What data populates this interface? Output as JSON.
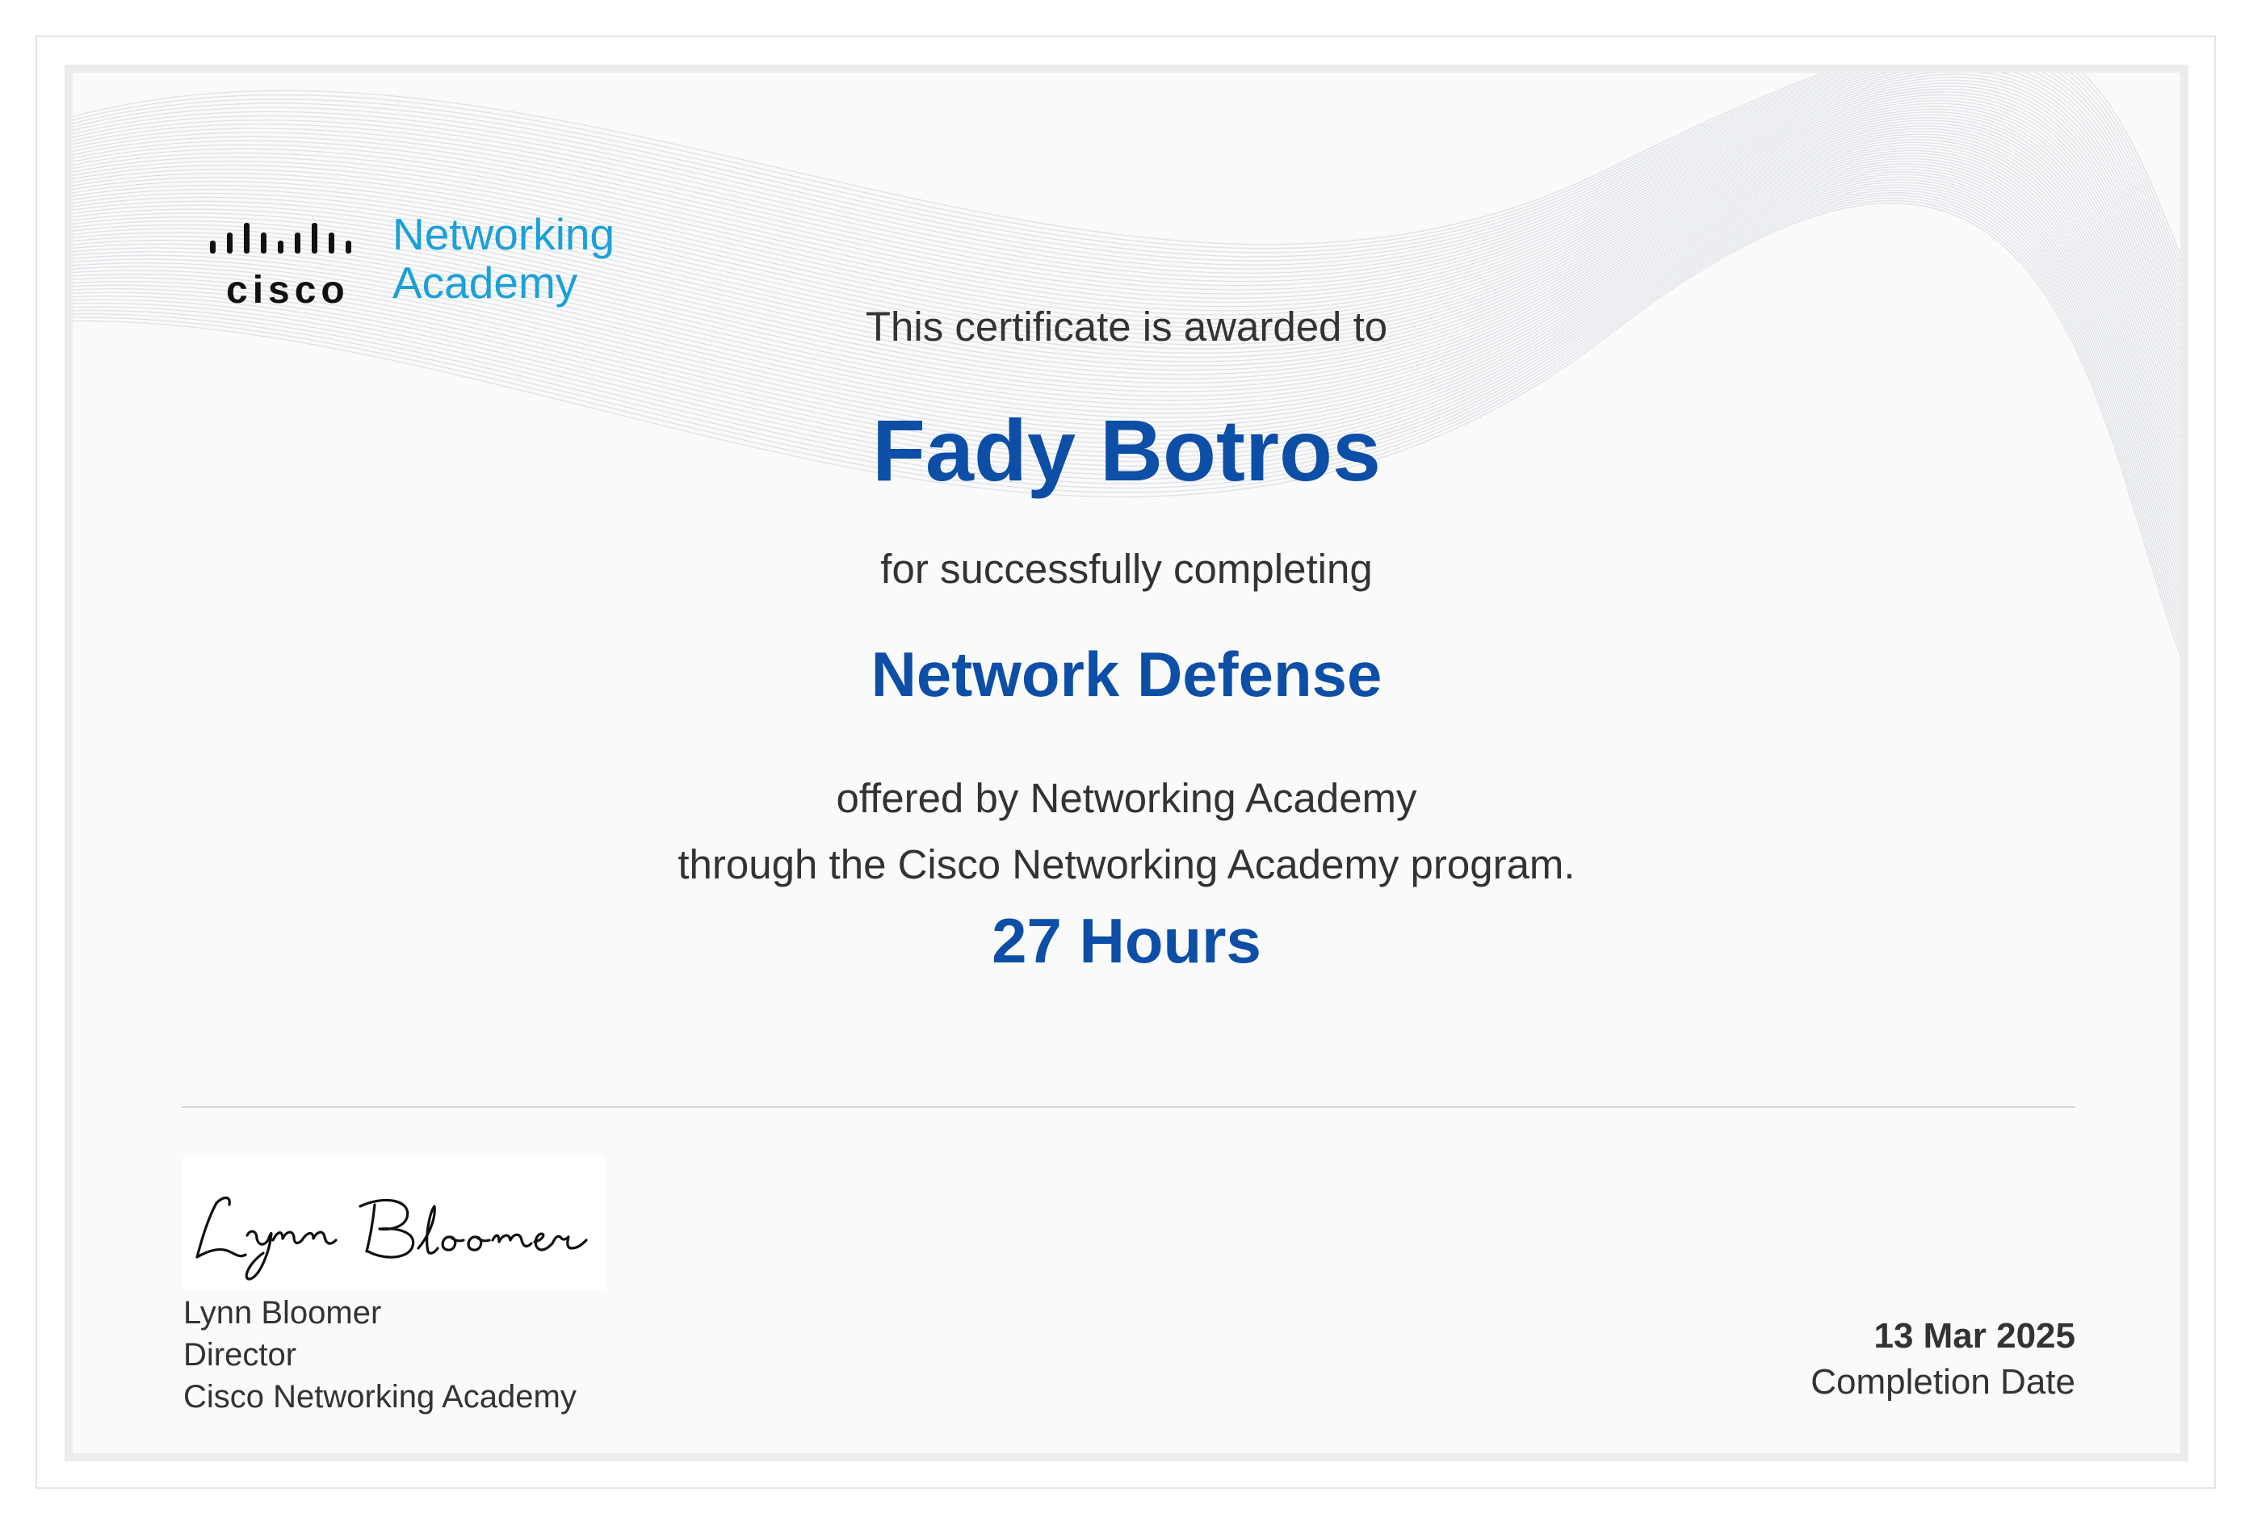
{
  "logo": {
    "wordmark": "cisco",
    "line1": "Networking",
    "line2": "Academy",
    "brand_color": "#1ba0d7"
  },
  "certificate": {
    "awarded_text": "This certificate is awarded to",
    "recipient": "Fady Botros",
    "completing_text": "for successfully completing",
    "course": "Network Defense",
    "offered_line1": "offered by Networking Academy",
    "offered_line2": "through the Cisco Networking Academy program.",
    "hours": "27 Hours",
    "accent_color": "#0d4ea6"
  },
  "signatory": {
    "signature_script": "Lynn Bloomer",
    "name": "Lynn Bloomer",
    "title": "Director",
    "organization": "Cisco Networking Academy"
  },
  "completion": {
    "date": "13 Mar 2025",
    "label": "Completion Date"
  }
}
